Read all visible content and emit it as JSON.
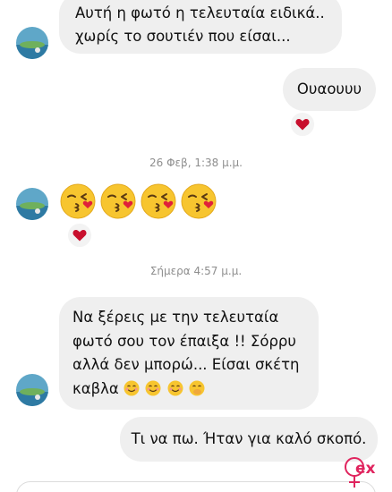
{
  "messages": {
    "m1": {
      "line1": "Αυτή η φωτό η τελευταία ειδικά..",
      "line2": "χωρίς το σουτιέν που είσαι..."
    },
    "m2": {
      "text": "Ουαουυυ"
    },
    "m3": {
      "emojis": [
        "kissing-heart-emoji",
        "kissing-heart-emoji",
        "kissing-heart-emoji",
        "kissing-heart-emoji"
      ]
    },
    "m4": {
      "line1": "Να ξέρεις με την τελευταία",
      "line2": "φωτό σου τον έπαιξα !! Σόρρυ",
      "line3": "αλλά δεν μπορώ... Είσαι σκέτη",
      "line4": "καβλα"
    },
    "m5": {
      "text": "Τι να πω. Ήταν για καλό σκοπό."
    }
  },
  "timestamps": {
    "t1": "26 Φεβ, 1:38 μ.μ.",
    "t2": "Σήμερα 4:57 μ.μ."
  },
  "reactions": {
    "icon": "heart-icon",
    "color": "#c8102e"
  },
  "watermark": {
    "text": "ex"
  },
  "colors": {
    "bubble": "#efefef",
    "timestamp": "#8e8e8e",
    "heart": "#c8102e",
    "watermark": "#e0245e"
  }
}
